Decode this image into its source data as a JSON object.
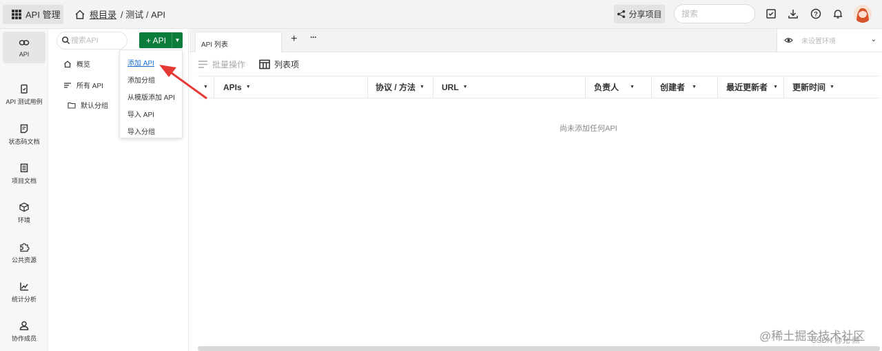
{
  "header": {
    "app_label": "API 管理",
    "breadcrumb_root": "根目录",
    "breadcrumb_path": "/ 测试 / API",
    "share_label": "分享项目",
    "search_placeholder": "搜索"
  },
  "rail": {
    "items": [
      {
        "label": "API",
        "icon": "link-icon"
      },
      {
        "label": "API 测试用例",
        "icon": "clipboard-check-icon"
      },
      {
        "label": "状态码文档",
        "icon": "doc-icon"
      },
      {
        "label": "项目文档",
        "icon": "book-icon"
      },
      {
        "label": "环境",
        "icon": "cube-icon"
      },
      {
        "label": "公共资源",
        "icon": "puzzle-icon"
      },
      {
        "label": "统计分析",
        "icon": "chart-icon"
      },
      {
        "label": "协作成员",
        "icon": "user-icon"
      }
    ]
  },
  "tree": {
    "search_placeholder": "搜索API",
    "add_button": "+ API",
    "items": [
      {
        "label": "概览",
        "icon": "home-icon"
      },
      {
        "label": "所有 API",
        "icon": "list-icon"
      },
      {
        "label": "默认分组",
        "icon": "folder-icon"
      }
    ]
  },
  "dropdown": {
    "options": [
      "添加 API",
      "添加分组",
      "从模版添加 API",
      "导入 API",
      "导入分组"
    ]
  },
  "tabs": {
    "active": "API 列表",
    "add": "+",
    "more": "···"
  },
  "env": {
    "placeholder": "未设置环境"
  },
  "toolbar": {
    "batch": "批量操作",
    "columns": "列表项"
  },
  "table": {
    "columns": [
      "APIs",
      "协议 / 方法",
      "URL",
      "负责人",
      "创建者",
      "最近更新者",
      "更新时间"
    ],
    "empty_text": "尚未添加任何API"
  },
  "watermark": {
    "main": "@稀土掘金技术社区",
    "sub": "CSDN @允 熙"
  },
  "colors": {
    "accent_green": "#0a7d3a",
    "link_blue": "#1a6fd6",
    "arrow_red": "#e53935"
  }
}
